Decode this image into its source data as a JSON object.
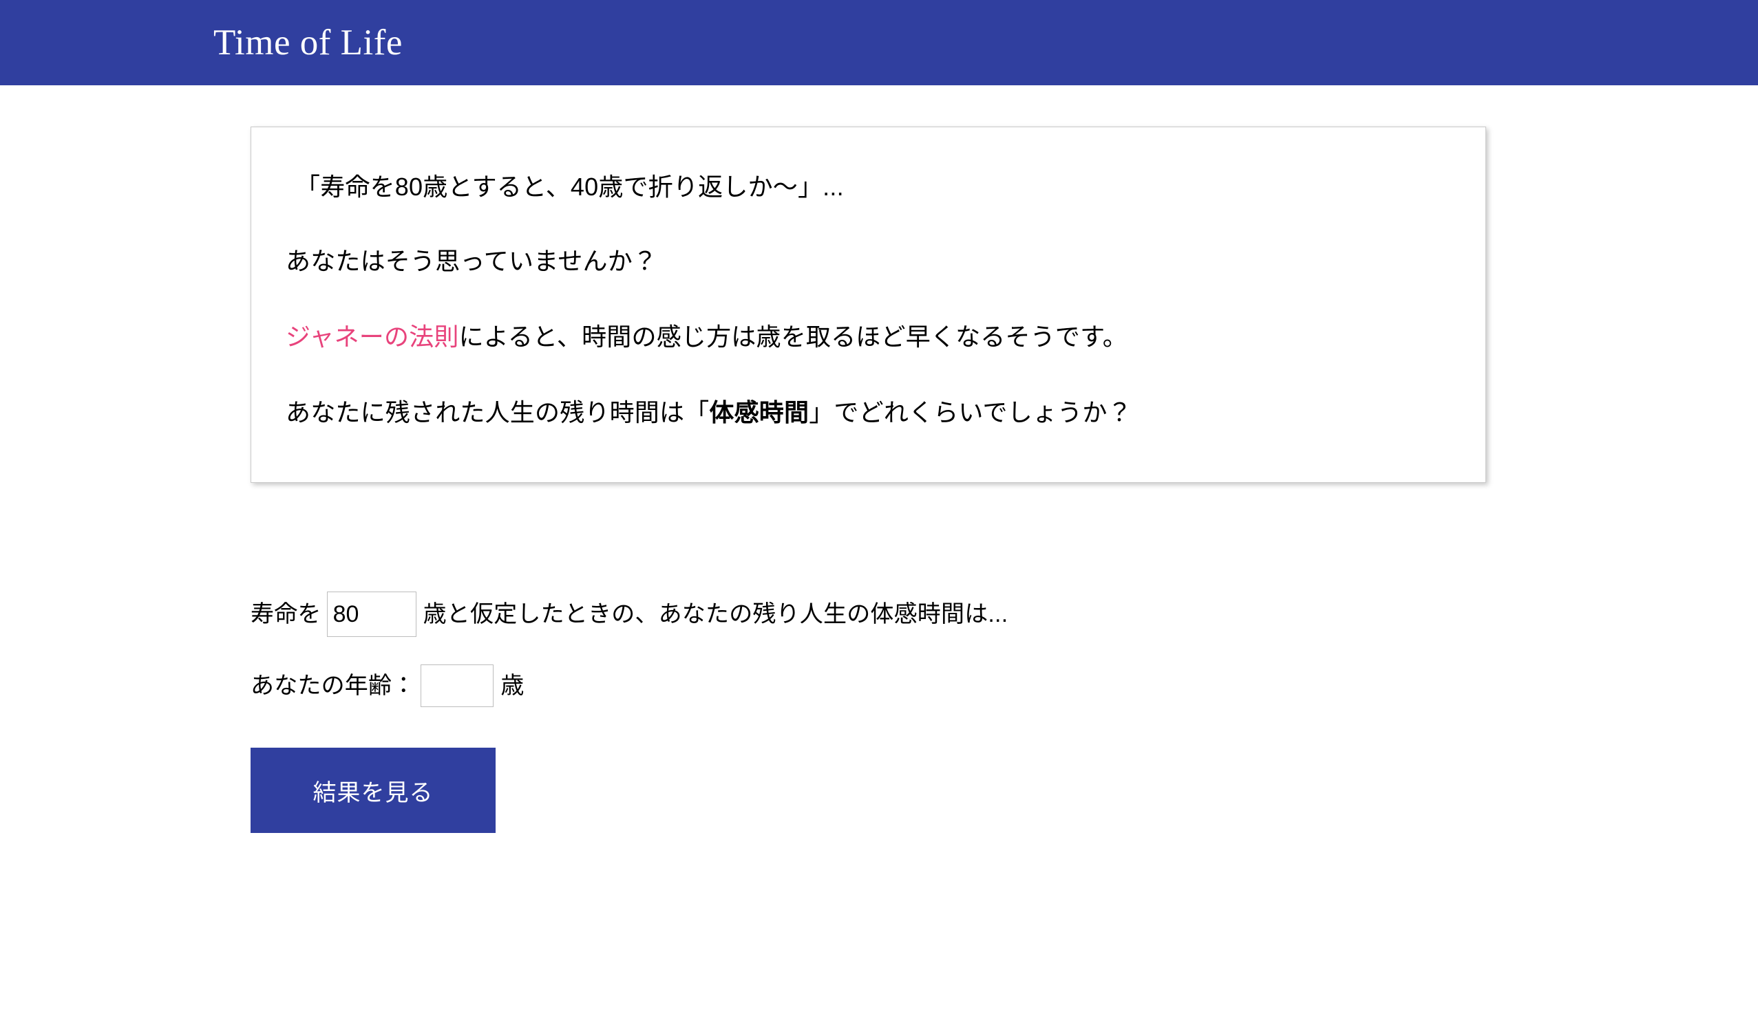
{
  "header": {
    "title": "Time of Life",
    "background_color": "#303f9f",
    "text_color": "#ffffff"
  },
  "intro_card": {
    "line1": "「寿命を80歳とすると、40歳で折り返しか〜」...",
    "line2": "あなたはそう思っていませんか？",
    "line3_link": "ジャネーの法則",
    "line3_rest": "によると、時間の感じ方は歳を取るほど早くなるそうです。",
    "line4_prefix": "あなたに残された人生の残り時間は「",
    "line4_strong": "体感時間",
    "line4_suffix": "」でどれくらいでしょうか？",
    "link_color": "#e8437c",
    "border_color": "#c9c9c9"
  },
  "form": {
    "lifespan_label_before": "寿命を",
    "lifespan_value": "80",
    "lifespan_placeholder": "",
    "lifespan_label_after": "歳と仮定したときの、あなたの残り人生の体感時間は...",
    "age_label": "あなたの年齢：",
    "age_value": "",
    "age_placeholder": "",
    "age_unit": "歳",
    "submit_label": "結果を見る",
    "submit_color": "#303f9f"
  }
}
